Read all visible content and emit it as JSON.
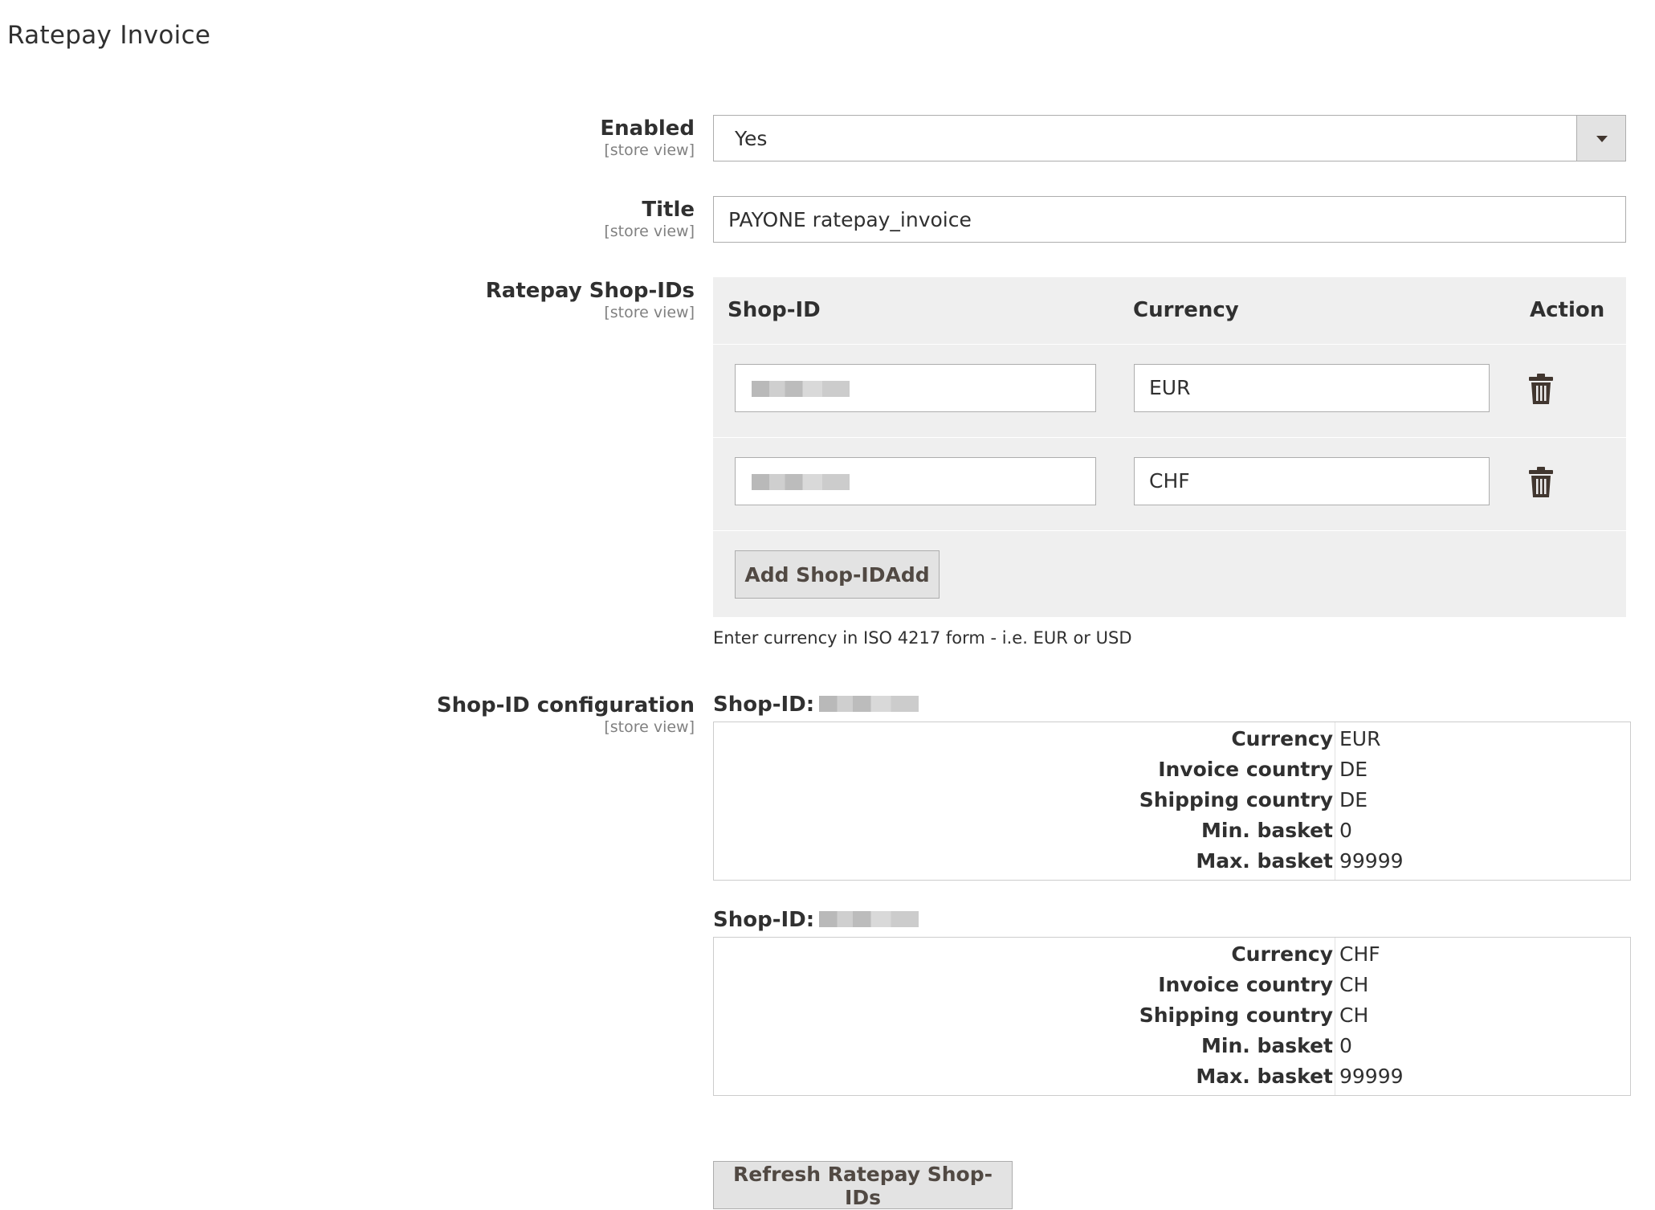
{
  "section": {
    "title": "Ratepay Invoice"
  },
  "scope_label": "[store view]",
  "enabled": {
    "label": "Enabled",
    "value": "Yes"
  },
  "title_field": {
    "label": "Title",
    "value": "PAYONE ratepay_invoice"
  },
  "shop_ids": {
    "label": "Ratepay Shop-IDs",
    "columns": [
      "Shop-ID",
      "Currency",
      "Action"
    ],
    "rows": [
      {
        "shop_id": "",
        "currency": "EUR"
      },
      {
        "shop_id": "",
        "currency": "CHF"
      }
    ],
    "add_button": "Add Shop-IDAdd",
    "hint": "Enter currency in ISO 4217 form - i.e. EUR or USD"
  },
  "config": {
    "label": "Shop-ID configuration",
    "shop_prefix": "Shop-ID:",
    "keys": [
      "Currency",
      "Invoice country",
      "Shipping country",
      "Min. basket",
      "Max. basket"
    ],
    "entries": [
      {
        "values": [
          "EUR",
          "DE",
          "DE",
          "0",
          "99999"
        ]
      },
      {
        "values": [
          "CHF",
          "CH",
          "CH",
          "0",
          "99999"
        ]
      }
    ]
  },
  "refresh_button": "Refresh Ratepay Shop-IDs",
  "icons": {
    "row_action": "trash-icon",
    "select_arrow": "caret-down-icon"
  }
}
